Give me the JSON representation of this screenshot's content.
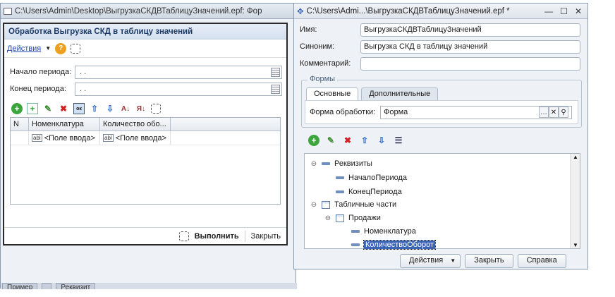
{
  "back_window": {
    "title": "C:\\Users\\Admin\\Desktop\\ВыгрузкаСКДВТаблицуЗначений.epf: Фор",
    "taskbar": [
      "Пример",
      "",
      "Реквизит"
    ]
  },
  "form": {
    "title": "Обработка  Выгрузка СКД в таблицу значений",
    "actions_label": "Действия",
    "start_label": "Начало периода:",
    "start_value": ". .",
    "end_label": "Конец периода:",
    "end_value": ". .",
    "columns": [
      "N",
      "Номенклатура",
      "Количество обо..."
    ],
    "row": [
      "",
      "<Поле ввода>",
      "<Поле ввода>"
    ],
    "execute_label": "Выполнить",
    "close_label": "Закрыть"
  },
  "editor": {
    "title": "C:\\Users\\Admi...\\ВыгрузкаСКДВТаблицуЗначений.epf *",
    "name_label": "Имя:",
    "name_value": "ВыгрузкаСКДВТаблицуЗначений",
    "synonym_label": "Синоним:",
    "synonym_value": "Выгрузка СКД в таблицу значений",
    "comment_label": "Комментарий:",
    "comment_value": "",
    "forms_legend": "Формы",
    "tab_main": "Основные",
    "tab_extra": "Дополнительные",
    "processing_form_label": "Форма обработки:",
    "processing_form_value": "Форма",
    "tree": {
      "requisites": "Реквизиты",
      "start_period": "НачалоПериода",
      "end_period": "КонецПериода",
      "tabular_parts": "Табличные части",
      "sales": "Продажи",
      "nomenclature": "Номенклатура",
      "turnover_qty": "КоличествоОборот"
    },
    "btn_actions": "Действия",
    "btn_close": "Закрыть",
    "btn_help": "Справка"
  },
  "colors": {
    "accent": "#3b64b8",
    "title_text": "#1c3b66"
  }
}
